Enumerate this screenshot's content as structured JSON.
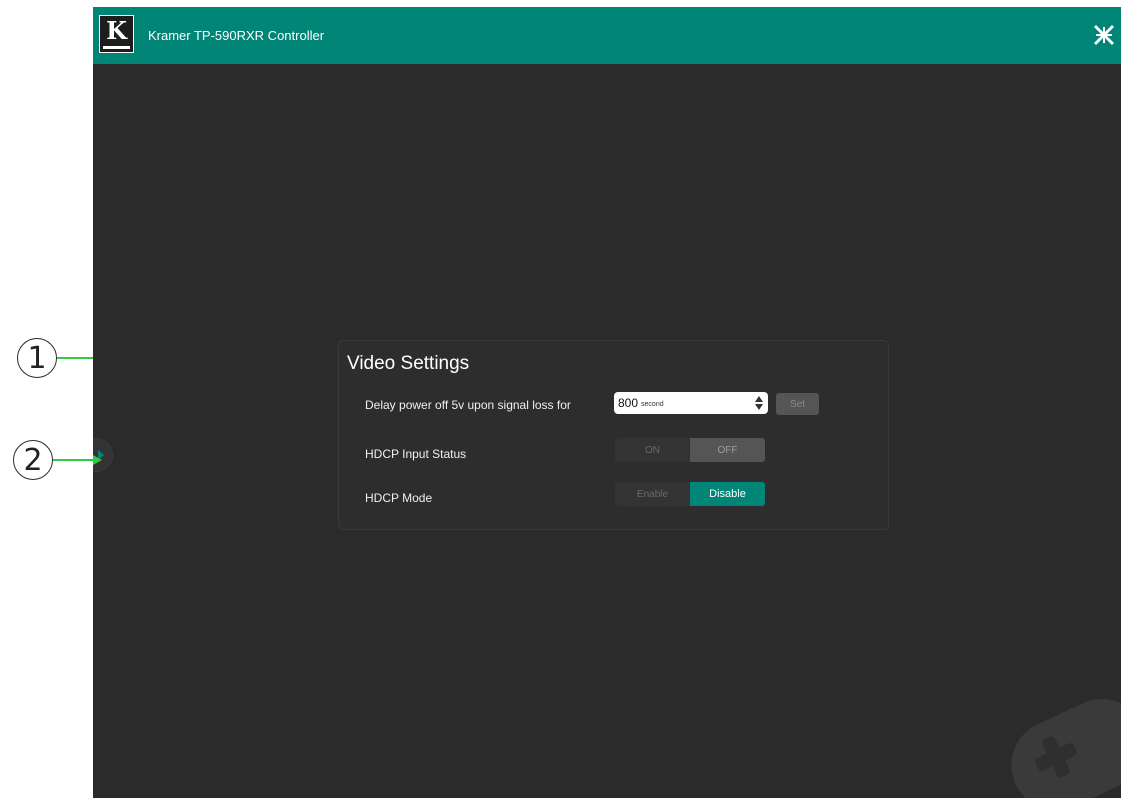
{
  "header": {
    "title": "Kramer TP-590RXR Controller",
    "logo_letter": "K",
    "fullscreen_icon": "fullscreen-exit-icon"
  },
  "side_toggle": {
    "icon": "chevron-right-icon"
  },
  "video_settings": {
    "title": "Video Settings",
    "delay": {
      "label": "Delay power off 5v upon signal loss for",
      "value": "800",
      "unit": "second",
      "set_label": "Set"
    },
    "hdcp_input_status": {
      "label": "HDCP Input Status",
      "on_label": "ON",
      "off_label": "OFF",
      "selected": "OFF"
    },
    "hdcp_mode": {
      "label": "HDCP Mode",
      "enable_label": "Enable",
      "disable_label": "Disable",
      "selected": "Disable"
    }
  },
  "callouts": [
    "1",
    "2"
  ],
  "colors": {
    "accent": "#008577",
    "background": "#2b2b2b",
    "callout_arrow": "#2ecc40"
  }
}
